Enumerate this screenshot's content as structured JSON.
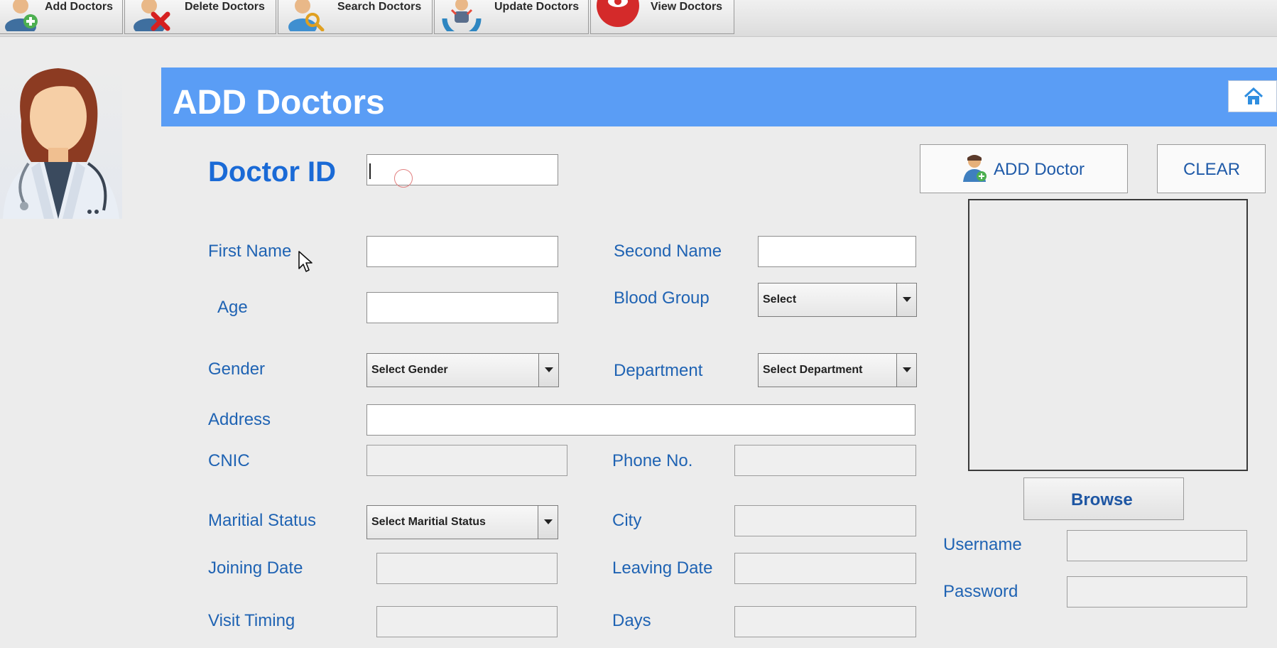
{
  "toolbar": {
    "buttons": [
      {
        "label": "Add Doctors",
        "icon": "add-user-icon"
      },
      {
        "label": "Delete Doctors",
        "icon": "delete-user-icon"
      },
      {
        "label": "Search Doctors",
        "icon": "search-user-icon"
      },
      {
        "label": "Update Doctors",
        "icon": "update-user-icon"
      },
      {
        "label": "View Doctors",
        "icon": "eye-icon"
      }
    ]
  },
  "header": {
    "title": "ADD Doctors",
    "home_icon": "home-icon",
    "color": "#5a9df5"
  },
  "form": {
    "doctor_id": {
      "label": "Doctor ID",
      "value": ""
    },
    "first_name": {
      "label": "First Name",
      "value": ""
    },
    "second_name": {
      "label": "Second Name",
      "value": ""
    },
    "age": {
      "label": "Age",
      "value": ""
    },
    "blood_group": {
      "label": "Blood Group",
      "selected": "Select"
    },
    "gender": {
      "label": "Gender",
      "selected": "Select Gender"
    },
    "department": {
      "label": "Department",
      "selected": "Select Department"
    },
    "address": {
      "label": "Address",
      "value": ""
    },
    "cnic": {
      "label": "CNIC",
      "value": ""
    },
    "phone": {
      "label": "Phone No.",
      "value": ""
    },
    "marital_status": {
      "label": "Maritial Status",
      "selected": "Select Maritial Status"
    },
    "city": {
      "label": "City",
      "value": ""
    },
    "joining_date": {
      "label": "Joining Date",
      "value": ""
    },
    "leaving_date": {
      "label": "Leaving Date",
      "value": ""
    },
    "visit_timing": {
      "label": "Visit Timing",
      "value": ""
    },
    "days": {
      "label": "Days",
      "value": ""
    },
    "username": {
      "label": "Username",
      "value": ""
    },
    "password": {
      "label": "Password",
      "value": ""
    }
  },
  "actions": {
    "add_label": "ADD Doctor",
    "clear_label": "CLEAR",
    "browse_label": "Browse"
  },
  "colors": {
    "label_blue": "#1f63b3",
    "background": "#ececec"
  }
}
